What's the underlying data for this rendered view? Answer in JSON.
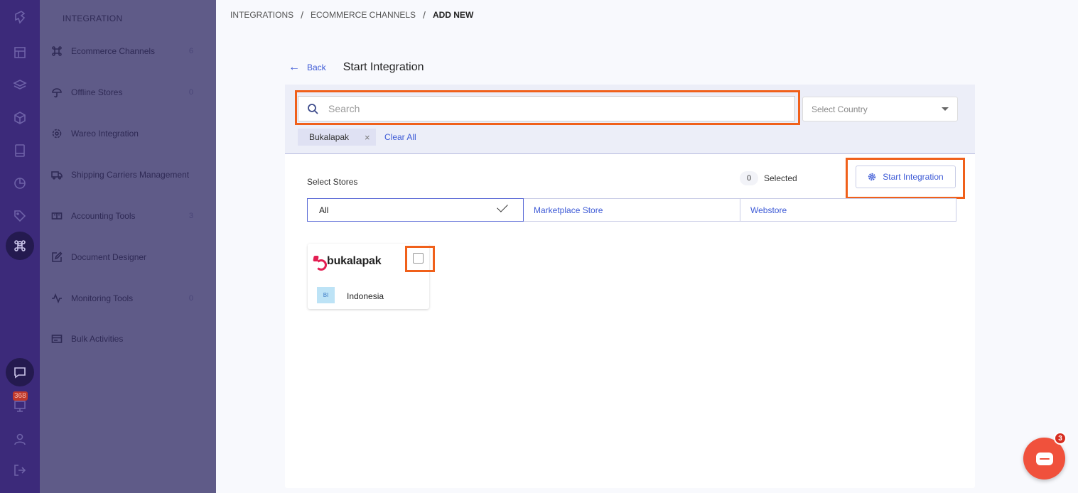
{
  "breadcrumb": {
    "items": [
      "INTEGRATIONS",
      "ECOMMERCE CHANNELS",
      "ADD NEW"
    ],
    "sep": "/"
  },
  "sidebar": {
    "section_title": "INTEGRATION",
    "items": [
      {
        "label": "Ecommerce Channels",
        "count": "6",
        "icon": "command-icon"
      },
      {
        "label": "Offline Stores",
        "count": "0",
        "icon": "umbrella-icon"
      },
      {
        "label": "Wareo Integration",
        "count": "",
        "icon": "gear-icon"
      },
      {
        "label": "Shipping Carriers Management",
        "count": "",
        "icon": "truck-icon"
      },
      {
        "label": "Accounting Tools",
        "count": "3",
        "icon": "book-icon"
      },
      {
        "label": "Document Designer",
        "count": "",
        "icon": "edit-icon"
      },
      {
        "label": "Monitoring Tools",
        "count": "0",
        "icon": "pulse-icon"
      },
      {
        "label": "Bulk Activities",
        "count": "",
        "icon": "card-icon"
      }
    ]
  },
  "rail": {
    "notification_count": "368"
  },
  "header": {
    "back_arrow": "←",
    "back_label": "Back",
    "title": "Start Integration"
  },
  "filters": {
    "search_placeholder": "Search",
    "search_value": "",
    "country_placeholder": "Select Country",
    "chip_label": "Bukalapak",
    "chip_remove": "×",
    "clear_all": "Clear All"
  },
  "stores": {
    "label": "Select Stores",
    "selected_count": "0",
    "selected_label": "Selected",
    "start_button": "Start Integration",
    "tabs": [
      "All",
      "Marketplace Store",
      "Webstore"
    ]
  },
  "store_cards": [
    {
      "logo_text": "bukalapak",
      "country_code": "BI",
      "country": "Indonesia",
      "checked": false
    }
  ],
  "chat_widget": {
    "badge": "3"
  },
  "colors": {
    "accent": "#3d5ad6",
    "highlight": "#f0601a",
    "rail": "#3c2a7a",
    "sidebar": "#5f5b88",
    "brand_bukalapak": "#e31e52"
  }
}
